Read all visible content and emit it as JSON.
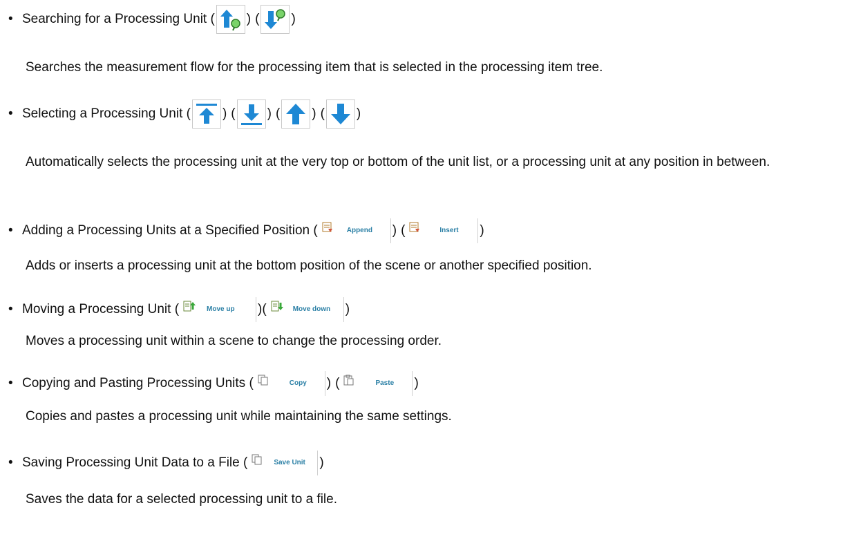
{
  "items": [
    {
      "title": "Searching for a Processing Unit (",
      "desc": "Searches the measurement flow for the processing item that is selected in the processing item tree.",
      "icons": [
        "search-up-icon",
        "search-down-icon"
      ]
    },
    {
      "title": "Selecting a Processing Unit (",
      "desc": "Automatically selects the processing unit at the very top or bottom of the unit list, or a processing unit at any position in between.",
      "icons": [
        "go-top-icon",
        "go-bottom-icon",
        "arrow-up-icon",
        "arrow-down-icon"
      ]
    },
    {
      "title": "Adding a Processing Units at a Specified Position (",
      "desc": "Adds or inserts a processing unit at the bottom position of the scene or another specified position.",
      "buttons": [
        "Append",
        "Insert"
      ]
    },
    {
      "title": "Moving a Processing Unit (",
      "desc": "Moves a processing unit within a scene to change the processing order.",
      "buttons": [
        "Move up",
        "Move down"
      ]
    },
    {
      "title": "Copying and Pasting Processing Units (",
      "desc": "Copies and pastes a processing unit while maintaining the same settings.",
      "buttons": [
        "Copy",
        "Paste"
      ]
    },
    {
      "title": "Saving Processing Unit Data to a File (",
      "desc": "Saves the data for a selected processing unit to a file.",
      "buttons": [
        "Save Unit"
      ]
    }
  ],
  "bullet": "•",
  "paren_close": ")",
  "paren_open": "(",
  "colors": {
    "arrow_blue": "#1e88d4",
    "button_text": "#2a7fa5",
    "border": "#c9c9c9"
  }
}
